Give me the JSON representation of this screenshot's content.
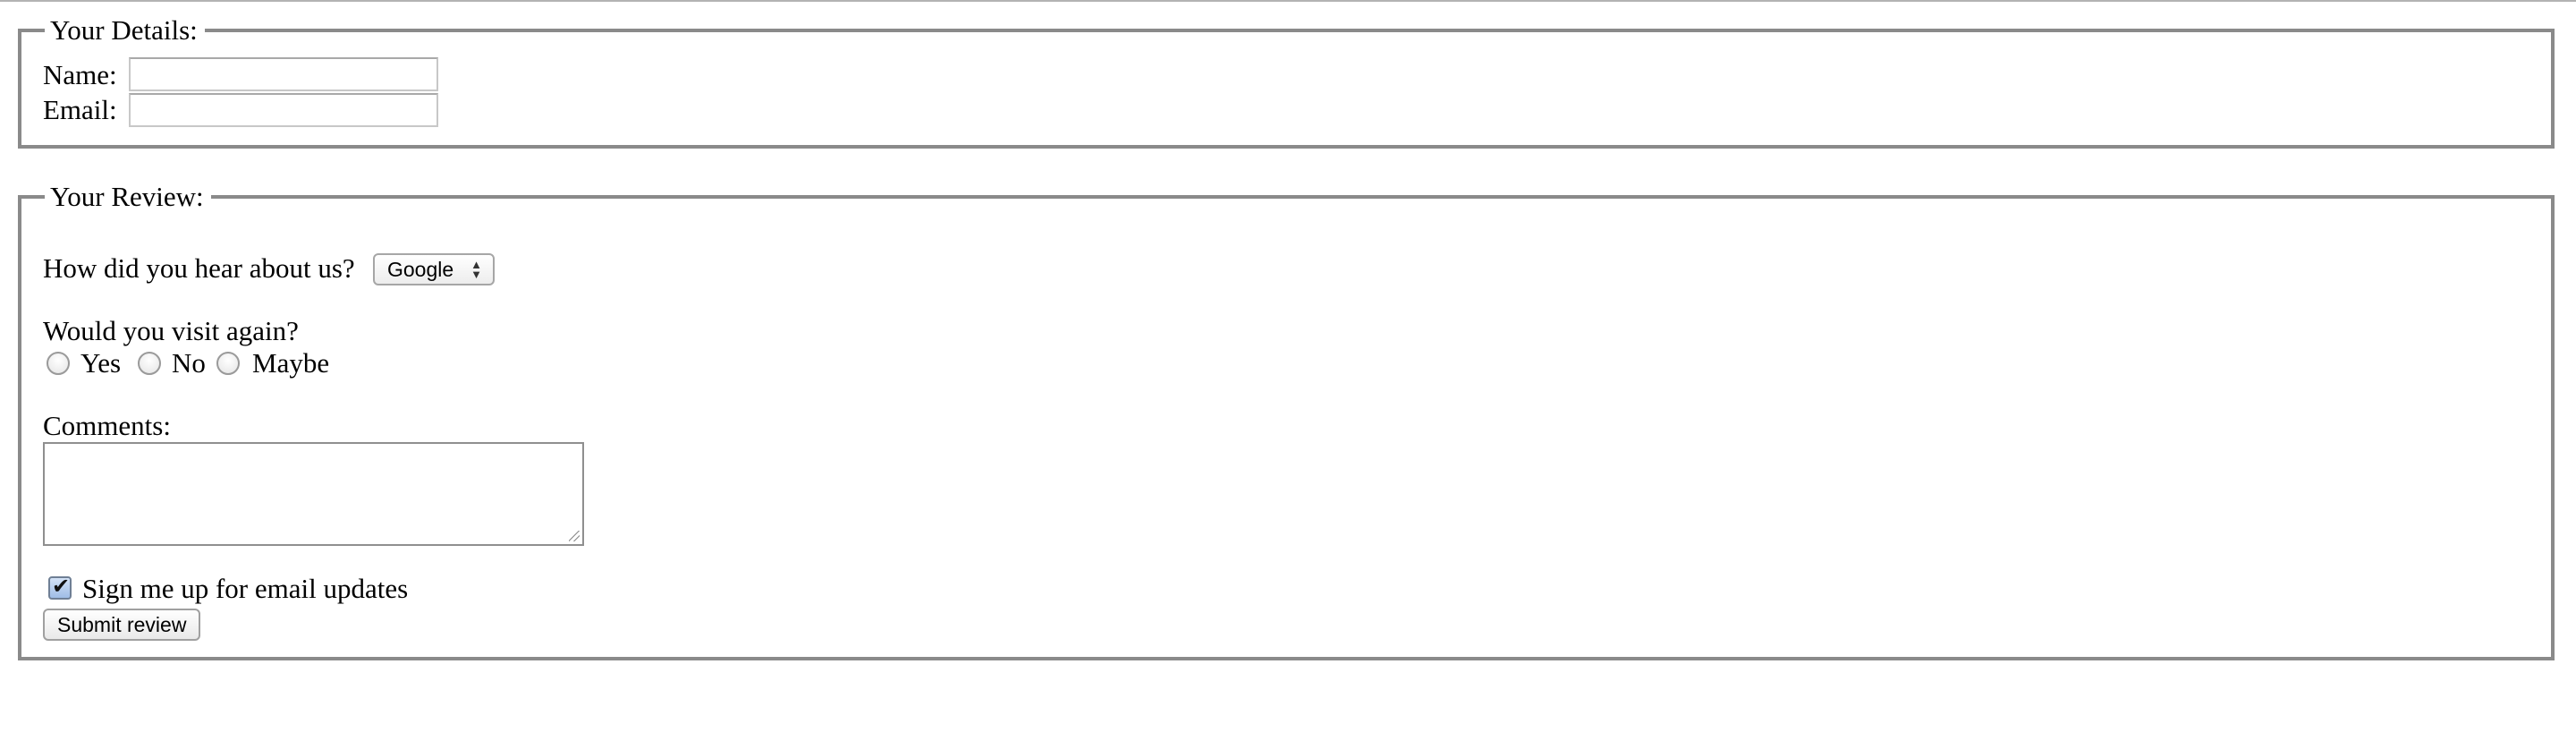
{
  "details": {
    "legend": "Your Details:",
    "name_label": "Name:",
    "name_value": "",
    "email_label": "Email:",
    "email_value": ""
  },
  "review": {
    "legend": "Your Review:",
    "heard_label": "How did you hear about us?",
    "heard_selected": "Google",
    "visit_question": "Would you visit again?",
    "visit_options": [
      "Yes",
      "No",
      "Maybe"
    ],
    "comments_label": "Comments:",
    "comments_value": "",
    "signup_label": "Sign me up for email updates",
    "signup_checked": true,
    "submit_label": "Submit review"
  }
}
